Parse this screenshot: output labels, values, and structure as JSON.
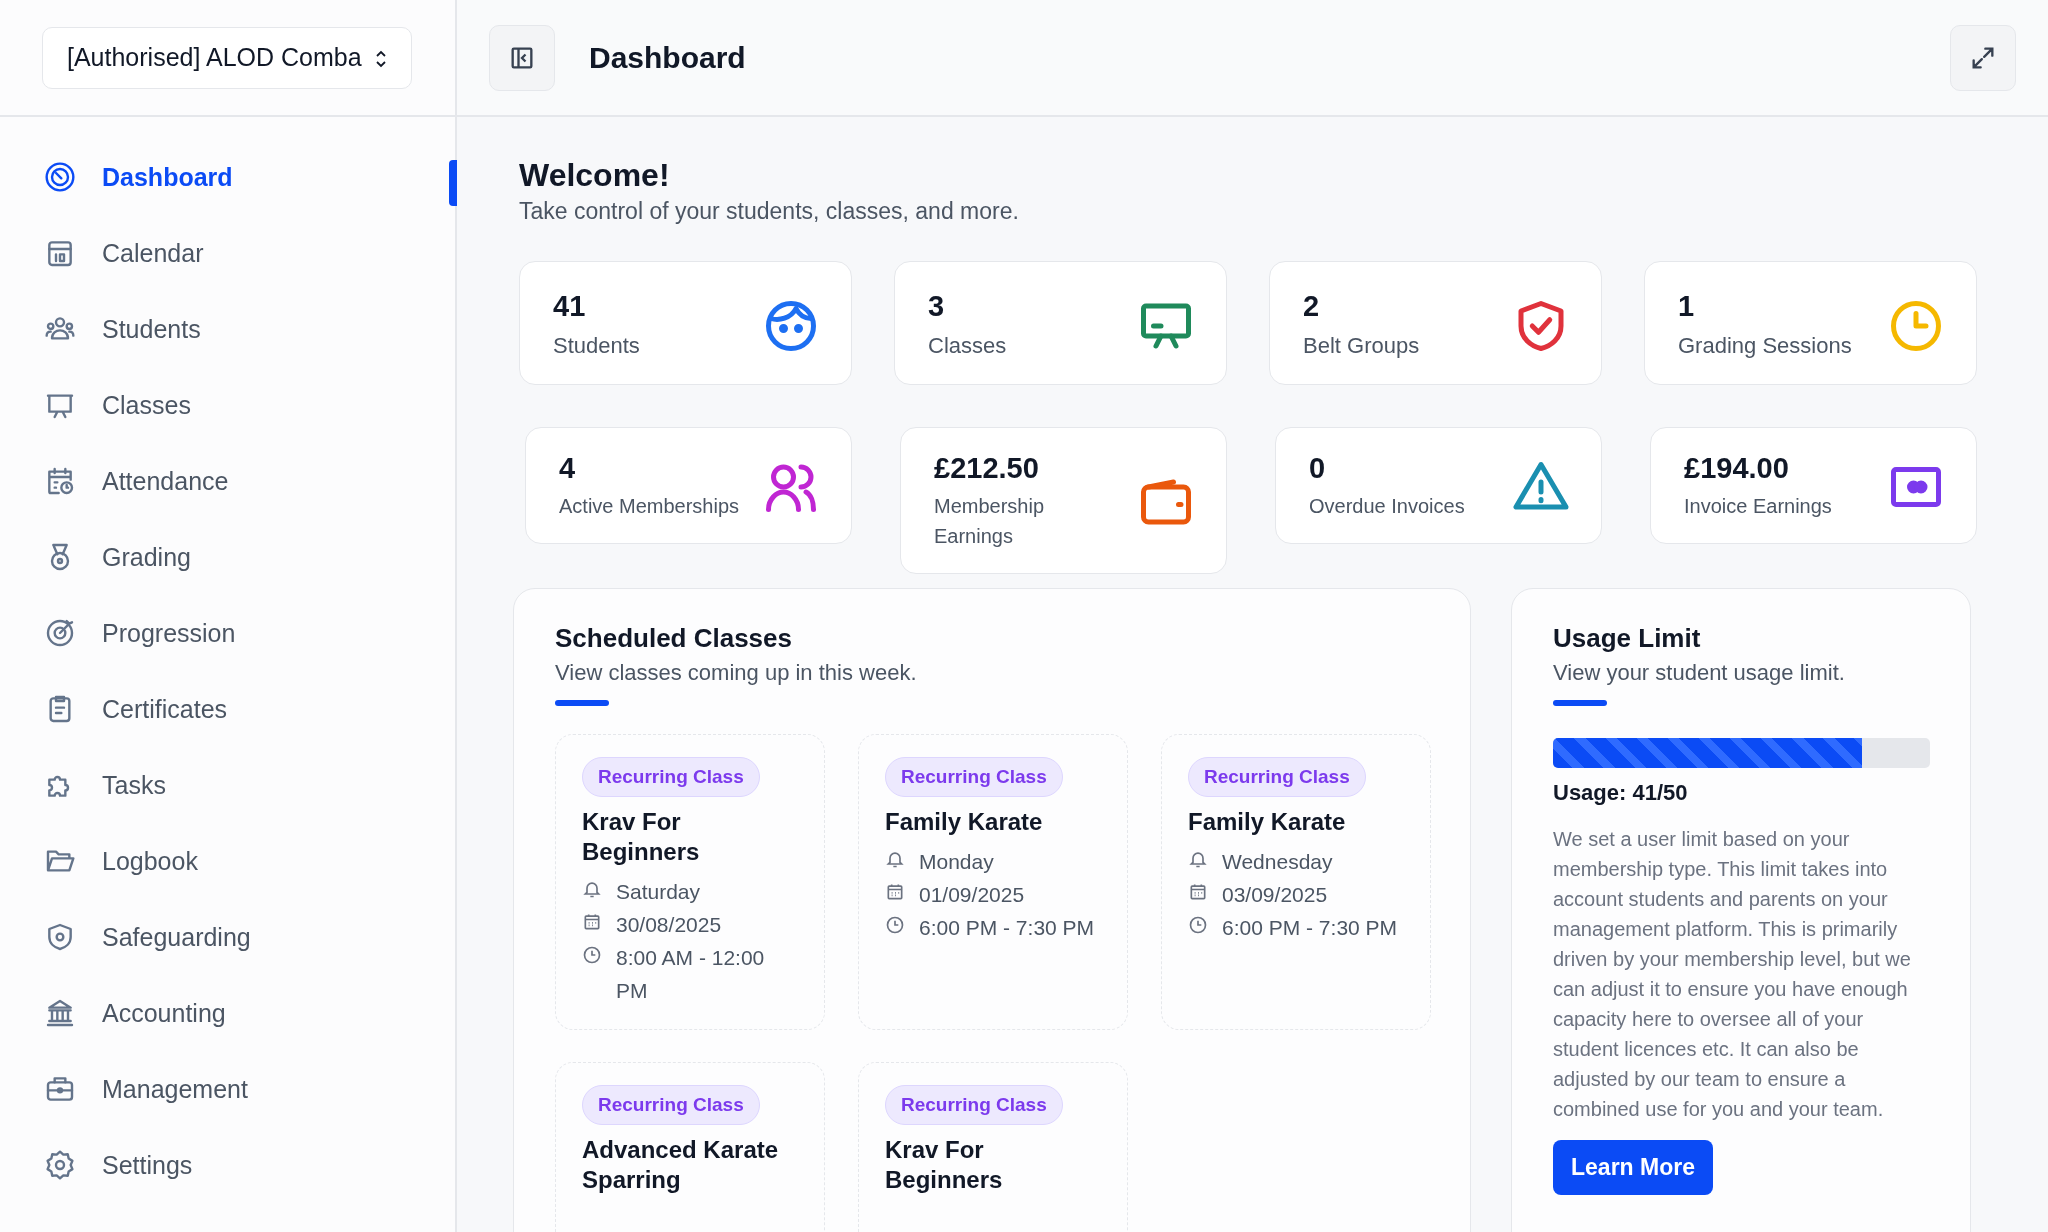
{
  "org_selector": {
    "value": "[Authorised] ALOD Comba"
  },
  "sidebar": {
    "items": [
      {
        "label": "Dashboard",
        "selected": true
      },
      {
        "label": "Calendar",
        "selected": false
      },
      {
        "label": "Students",
        "selected": false
      },
      {
        "label": "Classes",
        "selected": false
      },
      {
        "label": "Attendance",
        "selected": false
      },
      {
        "label": "Grading",
        "selected": false
      },
      {
        "label": "Progression",
        "selected": false
      },
      {
        "label": "Certificates",
        "selected": false
      },
      {
        "label": "Tasks",
        "selected": false
      },
      {
        "label": "Logbook",
        "selected": false
      },
      {
        "label": "Safeguarding",
        "selected": false
      },
      {
        "label": "Accounting",
        "selected": false
      },
      {
        "label": "Management",
        "selected": false
      },
      {
        "label": "Settings",
        "selected": false
      }
    ]
  },
  "header": {
    "title": "Dashboard"
  },
  "welcome": {
    "title": "Welcome!",
    "subtitle": "Take control of your students, classes, and more."
  },
  "stats": [
    {
      "value": "41",
      "label": "Students",
      "color": "#1d6ff2"
    },
    {
      "value": "3",
      "label": "Classes",
      "color": "#1f8a5b"
    },
    {
      "value": "2",
      "label": "Belt Groups",
      "color": "#e0323c"
    },
    {
      "value": "1",
      "label": "Grading Sessions",
      "color": "#f5b800"
    },
    {
      "value": "4",
      "label": "Active Memberships",
      "color": "#c026d3"
    },
    {
      "value": "£212.50",
      "label": "Membership Earnings",
      "color": "#ea580c"
    },
    {
      "value": "0",
      "label": "Overdue Invoices",
      "color": "#1a8fb0"
    },
    {
      "value": "£194.00",
      "label": "Invoice Earnings",
      "color": "#7c3aed"
    }
  ],
  "scheduled": {
    "title": "Scheduled Classes",
    "subtitle": "View classes coming up in this week.",
    "classes": [
      {
        "tag": "Recurring Class",
        "name": "Krav For Beginners",
        "day": "Saturday",
        "date": "30/08/2025",
        "time": "8:00 AM - 12:00 PM"
      },
      {
        "tag": "Recurring Class",
        "name": "Family Karate",
        "day": "Monday",
        "date": "01/09/2025",
        "time": "6:00 PM - 7:30 PM"
      },
      {
        "tag": "Recurring Class",
        "name": "Family Karate",
        "day": "Wednesday",
        "date": "03/09/2025",
        "time": "6:00 PM - 7:30 PM"
      },
      {
        "tag": "Recurring Class",
        "name": "Advanced Karate Sparring"
      },
      {
        "tag": "Recurring Class",
        "name": "Krav For Beginners"
      }
    ]
  },
  "usage": {
    "title": "Usage Limit",
    "subtitle": "View your student usage limit.",
    "level": 0.82,
    "reading": "Usage: 41/50",
    "description": "We set a user limit based on your membership type. This limit takes into account students and parents on your management platform. This is primarily driven by your membership level, but we can adjust it to ensure you have enough capacity here to oversee all of your student licences etc. It can also be adjusted by our team to ensure a combined use for you and your team.",
    "button": "Learn More"
  }
}
